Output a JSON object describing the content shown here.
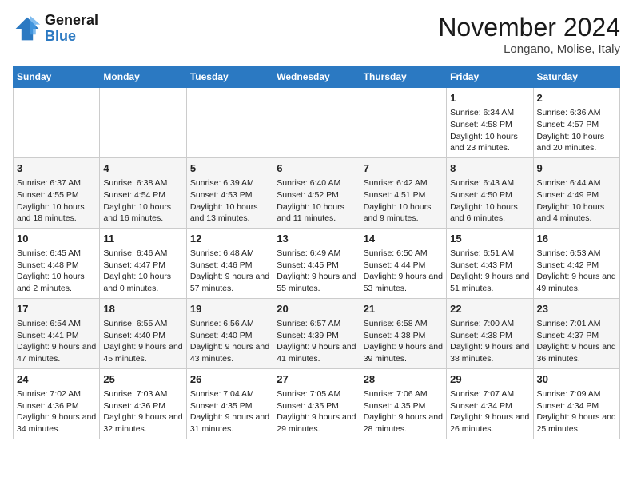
{
  "header": {
    "logo_line1": "General",
    "logo_line2": "Blue",
    "month": "November 2024",
    "location": "Longano, Molise, Italy"
  },
  "days_of_week": [
    "Sunday",
    "Monday",
    "Tuesday",
    "Wednesday",
    "Thursday",
    "Friday",
    "Saturday"
  ],
  "weeks": [
    [
      {
        "day": "",
        "info": ""
      },
      {
        "day": "",
        "info": ""
      },
      {
        "day": "",
        "info": ""
      },
      {
        "day": "",
        "info": ""
      },
      {
        "day": "",
        "info": ""
      },
      {
        "day": "1",
        "info": "Sunrise: 6:34 AM\nSunset: 4:58 PM\nDaylight: 10 hours and 23 minutes."
      },
      {
        "day": "2",
        "info": "Sunrise: 6:36 AM\nSunset: 4:57 PM\nDaylight: 10 hours and 20 minutes."
      }
    ],
    [
      {
        "day": "3",
        "info": "Sunrise: 6:37 AM\nSunset: 4:55 PM\nDaylight: 10 hours and 18 minutes."
      },
      {
        "day": "4",
        "info": "Sunrise: 6:38 AM\nSunset: 4:54 PM\nDaylight: 10 hours and 16 minutes."
      },
      {
        "day": "5",
        "info": "Sunrise: 6:39 AM\nSunset: 4:53 PM\nDaylight: 10 hours and 13 minutes."
      },
      {
        "day": "6",
        "info": "Sunrise: 6:40 AM\nSunset: 4:52 PM\nDaylight: 10 hours and 11 minutes."
      },
      {
        "day": "7",
        "info": "Sunrise: 6:42 AM\nSunset: 4:51 PM\nDaylight: 10 hours and 9 minutes."
      },
      {
        "day": "8",
        "info": "Sunrise: 6:43 AM\nSunset: 4:50 PM\nDaylight: 10 hours and 6 minutes."
      },
      {
        "day": "9",
        "info": "Sunrise: 6:44 AM\nSunset: 4:49 PM\nDaylight: 10 hours and 4 minutes."
      }
    ],
    [
      {
        "day": "10",
        "info": "Sunrise: 6:45 AM\nSunset: 4:48 PM\nDaylight: 10 hours and 2 minutes."
      },
      {
        "day": "11",
        "info": "Sunrise: 6:46 AM\nSunset: 4:47 PM\nDaylight: 10 hours and 0 minutes."
      },
      {
        "day": "12",
        "info": "Sunrise: 6:48 AM\nSunset: 4:46 PM\nDaylight: 9 hours and 57 minutes."
      },
      {
        "day": "13",
        "info": "Sunrise: 6:49 AM\nSunset: 4:45 PM\nDaylight: 9 hours and 55 minutes."
      },
      {
        "day": "14",
        "info": "Sunrise: 6:50 AM\nSunset: 4:44 PM\nDaylight: 9 hours and 53 minutes."
      },
      {
        "day": "15",
        "info": "Sunrise: 6:51 AM\nSunset: 4:43 PM\nDaylight: 9 hours and 51 minutes."
      },
      {
        "day": "16",
        "info": "Sunrise: 6:53 AM\nSunset: 4:42 PM\nDaylight: 9 hours and 49 minutes."
      }
    ],
    [
      {
        "day": "17",
        "info": "Sunrise: 6:54 AM\nSunset: 4:41 PM\nDaylight: 9 hours and 47 minutes."
      },
      {
        "day": "18",
        "info": "Sunrise: 6:55 AM\nSunset: 4:40 PM\nDaylight: 9 hours and 45 minutes."
      },
      {
        "day": "19",
        "info": "Sunrise: 6:56 AM\nSunset: 4:40 PM\nDaylight: 9 hours and 43 minutes."
      },
      {
        "day": "20",
        "info": "Sunrise: 6:57 AM\nSunset: 4:39 PM\nDaylight: 9 hours and 41 minutes."
      },
      {
        "day": "21",
        "info": "Sunrise: 6:58 AM\nSunset: 4:38 PM\nDaylight: 9 hours and 39 minutes."
      },
      {
        "day": "22",
        "info": "Sunrise: 7:00 AM\nSunset: 4:38 PM\nDaylight: 9 hours and 38 minutes."
      },
      {
        "day": "23",
        "info": "Sunrise: 7:01 AM\nSunset: 4:37 PM\nDaylight: 9 hours and 36 minutes."
      }
    ],
    [
      {
        "day": "24",
        "info": "Sunrise: 7:02 AM\nSunset: 4:36 PM\nDaylight: 9 hours and 34 minutes."
      },
      {
        "day": "25",
        "info": "Sunrise: 7:03 AM\nSunset: 4:36 PM\nDaylight: 9 hours and 32 minutes."
      },
      {
        "day": "26",
        "info": "Sunrise: 7:04 AM\nSunset: 4:35 PM\nDaylight: 9 hours and 31 minutes."
      },
      {
        "day": "27",
        "info": "Sunrise: 7:05 AM\nSunset: 4:35 PM\nDaylight: 9 hours and 29 minutes."
      },
      {
        "day": "28",
        "info": "Sunrise: 7:06 AM\nSunset: 4:35 PM\nDaylight: 9 hours and 28 minutes."
      },
      {
        "day": "29",
        "info": "Sunrise: 7:07 AM\nSunset: 4:34 PM\nDaylight: 9 hours and 26 minutes."
      },
      {
        "day": "30",
        "info": "Sunrise: 7:09 AM\nSunset: 4:34 PM\nDaylight: 9 hours and 25 minutes."
      }
    ]
  ]
}
